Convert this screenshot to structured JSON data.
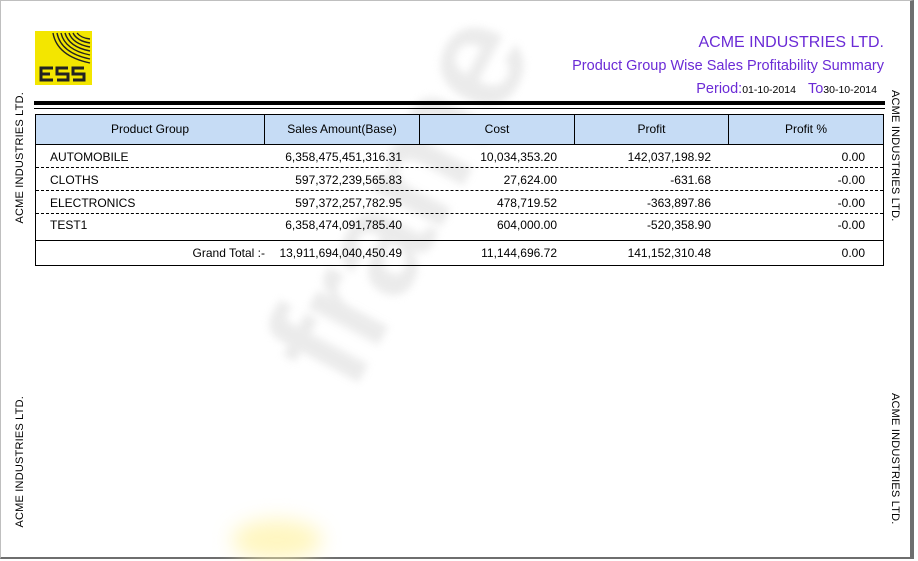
{
  "company": "ACME INDUSTRIES LTD.",
  "report_title": "Product Group Wise Sales Profitability Summary",
  "period": {
    "label": "Period:",
    "from": "01-10-2014",
    "to_label": "To",
    "to": "30-10-2014"
  },
  "side_text": "ACME INDUSTRIES LTD.",
  "logo": {
    "text": "ESS",
    "bg_color": "#f3e600"
  },
  "watermark": "frame",
  "columns": [
    "Product Group",
    "Sales Amount(Base)",
    "Cost",
    "Profit",
    "Profit %"
  ],
  "rows": [
    {
      "group": "AUTOMOBILE",
      "sales": "6,358,475,451,316.31",
      "cost": "10,034,353.20",
      "profit": "142,037,198.92",
      "pct": "0.00"
    },
    {
      "group": "CLOTHS",
      "sales": "597,372,239,565.83",
      "cost": "27,624.00",
      "profit": "-631.68",
      "pct": "-0.00"
    },
    {
      "group": "ELECTRONICS",
      "sales": "597,372,257,782.95",
      "cost": "478,719.52",
      "profit": "-363,897.86",
      "pct": "-0.00"
    },
    {
      "group": "TEST1",
      "sales": "6,358,474,091,785.40",
      "cost": "604,000.00",
      "profit": "-520,358.90",
      "pct": "-0.00"
    }
  ],
  "total": {
    "label": "Grand Total :-",
    "sales": "13,911,694,040,450.49",
    "cost": "11,144,696.72",
    "profit": "141,152,310.48",
    "pct": "0.00"
  },
  "colors": {
    "accent": "#6b2bd6",
    "header_bg": "#c6dcf5"
  }
}
